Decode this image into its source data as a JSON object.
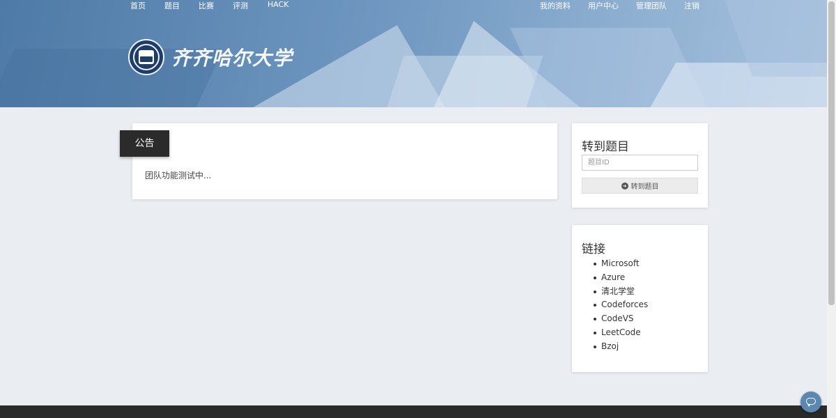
{
  "nav": {
    "left": [
      {
        "label": "首页"
      },
      {
        "label": "题目"
      },
      {
        "label": "比赛"
      },
      {
        "label": "评测"
      },
      {
        "label": "HACK"
      }
    ],
    "right": [
      {
        "label": "我的资料"
      },
      {
        "label": "用户中心"
      },
      {
        "label": "管理团队"
      },
      {
        "label": "注销"
      }
    ]
  },
  "logo": {
    "text": "齐齐哈尔大学"
  },
  "notice": {
    "tag": "公告",
    "content": "团队功能测试中..."
  },
  "goto": {
    "title": "转到题目",
    "placeholder": "题目ID",
    "button_label": "转到题目",
    "button_icon": "arrow-circle-right-icon"
  },
  "links": {
    "title": "链接",
    "items": [
      {
        "label": "Microsoft"
      },
      {
        "label": "Azure"
      },
      {
        "label": "清北学堂"
      },
      {
        "label": "Codeforces"
      },
      {
        "label": "CodeVS"
      },
      {
        "label": "LeetCode"
      },
      {
        "label": "Bzoj"
      }
    ]
  },
  "colors": {
    "banner": "#6f97c0",
    "notice_tag": "#2b2b2b",
    "background": "#eaeef2",
    "footer": "#2a2a2a",
    "chat_button": "#5b87b1"
  }
}
